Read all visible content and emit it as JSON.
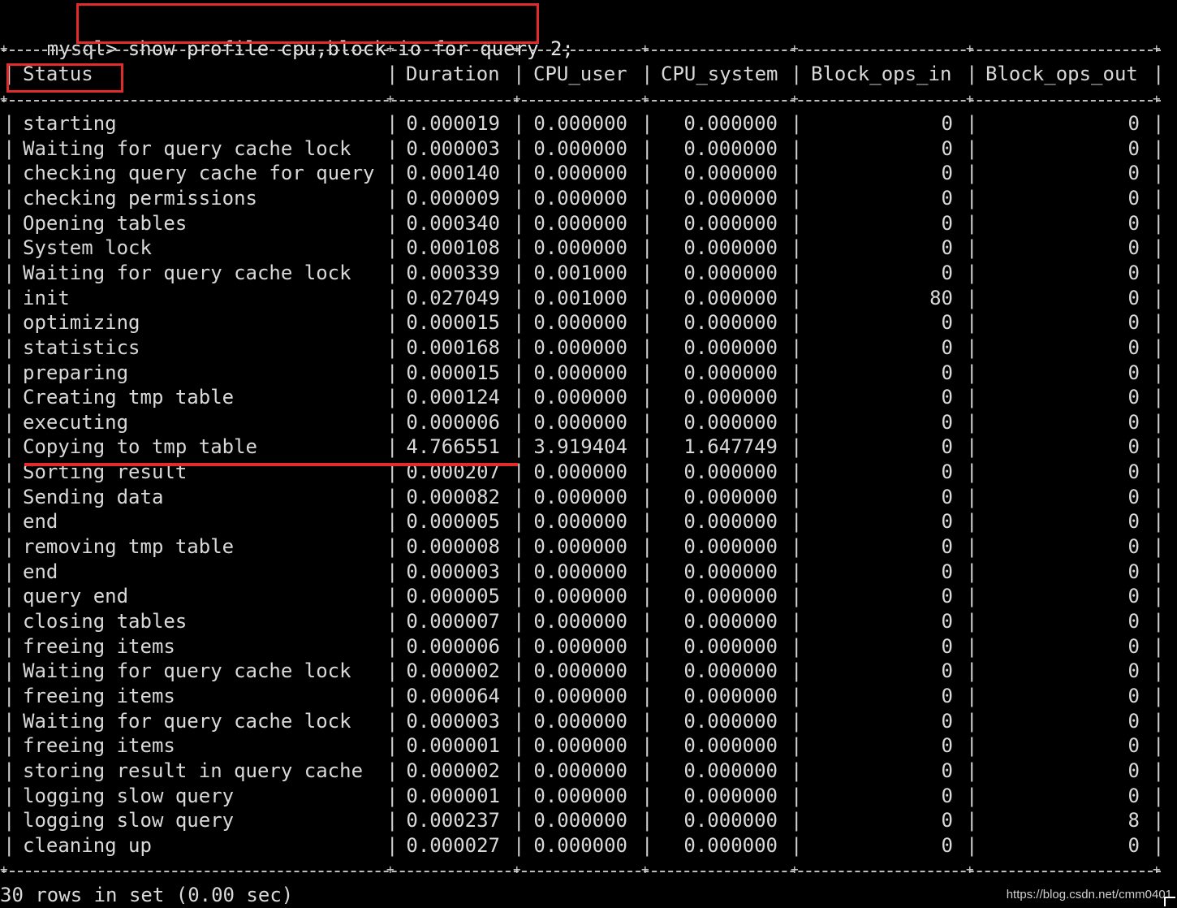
{
  "terminal": {
    "prompt": "mysql>",
    "command": "show profile cpu,block io for query 2;",
    "headers": [
      "Status",
      "Duration",
      "CPU_user",
      "CPU_system",
      "Block_ops_in",
      "Block_ops_out"
    ],
    "rows": [
      [
        "starting",
        "0.000019",
        "0.000000",
        "0.000000",
        "0",
        "0"
      ],
      [
        "Waiting for query cache lock",
        "0.000003",
        "0.000000",
        "0.000000",
        "0",
        "0"
      ],
      [
        "checking query cache for query",
        "0.000140",
        "0.000000",
        "0.000000",
        "0",
        "0"
      ],
      [
        "checking permissions",
        "0.000009",
        "0.000000",
        "0.000000",
        "0",
        "0"
      ],
      [
        "Opening tables",
        "0.000340",
        "0.000000",
        "0.000000",
        "0",
        "0"
      ],
      [
        "System lock",
        "0.000108",
        "0.000000",
        "0.000000",
        "0",
        "0"
      ],
      [
        "Waiting for query cache lock",
        "0.000339",
        "0.001000",
        "0.000000",
        "0",
        "0"
      ],
      [
        "init",
        "0.027049",
        "0.001000",
        "0.000000",
        "80",
        "0"
      ],
      [
        "optimizing",
        "0.000015",
        "0.000000",
        "0.000000",
        "0",
        "0"
      ],
      [
        "statistics",
        "0.000168",
        "0.000000",
        "0.000000",
        "0",
        "0"
      ],
      [
        "preparing",
        "0.000015",
        "0.000000",
        "0.000000",
        "0",
        "0"
      ],
      [
        "Creating tmp table",
        "0.000124",
        "0.000000",
        "0.000000",
        "0",
        "0"
      ],
      [
        "executing",
        "0.000006",
        "0.000000",
        "0.000000",
        "0",
        "0"
      ],
      [
        "Copying to tmp table",
        "4.766551",
        "3.919404",
        "1.647749",
        "0",
        "0"
      ],
      [
        "Sorting result",
        "0.000207",
        "0.000000",
        "0.000000",
        "0",
        "0"
      ],
      [
        "Sending data",
        "0.000082",
        "0.000000",
        "0.000000",
        "0",
        "0"
      ],
      [
        "end",
        "0.000005",
        "0.000000",
        "0.000000",
        "0",
        "0"
      ],
      [
        "removing tmp table",
        "0.000008",
        "0.000000",
        "0.000000",
        "0",
        "0"
      ],
      [
        "end",
        "0.000003",
        "0.000000",
        "0.000000",
        "0",
        "0"
      ],
      [
        "query end",
        "0.000005",
        "0.000000",
        "0.000000",
        "0",
        "0"
      ],
      [
        "closing tables",
        "0.000007",
        "0.000000",
        "0.000000",
        "0",
        "0"
      ],
      [
        "freeing items",
        "0.000006",
        "0.000000",
        "0.000000",
        "0",
        "0"
      ],
      [
        "Waiting for query cache lock",
        "0.000002",
        "0.000000",
        "0.000000",
        "0",
        "0"
      ],
      [
        "freeing items",
        "0.000064",
        "0.000000",
        "0.000000",
        "0",
        "0"
      ],
      [
        "Waiting for query cache lock",
        "0.000003",
        "0.000000",
        "0.000000",
        "0",
        "0"
      ],
      [
        "freeing items",
        "0.000001",
        "0.000000",
        "0.000000",
        "0",
        "0"
      ],
      [
        "storing result in query cache",
        "0.000002",
        "0.000000",
        "0.000000",
        "0",
        "0"
      ],
      [
        "logging slow query",
        "0.000001",
        "0.000000",
        "0.000000",
        "0",
        "0"
      ],
      [
        "logging slow query",
        "0.000237",
        "0.000000",
        "0.000000",
        "0",
        "8"
      ],
      [
        "cleaning up",
        "0.000027",
        "0.000000",
        "0.000000",
        "0",
        "0"
      ]
    ],
    "footer": "30 rows in set (0.00 sec)",
    "watermark": "https://blog.csdn.net/cmm0401"
  },
  "annotation_color": "#e32b2b"
}
